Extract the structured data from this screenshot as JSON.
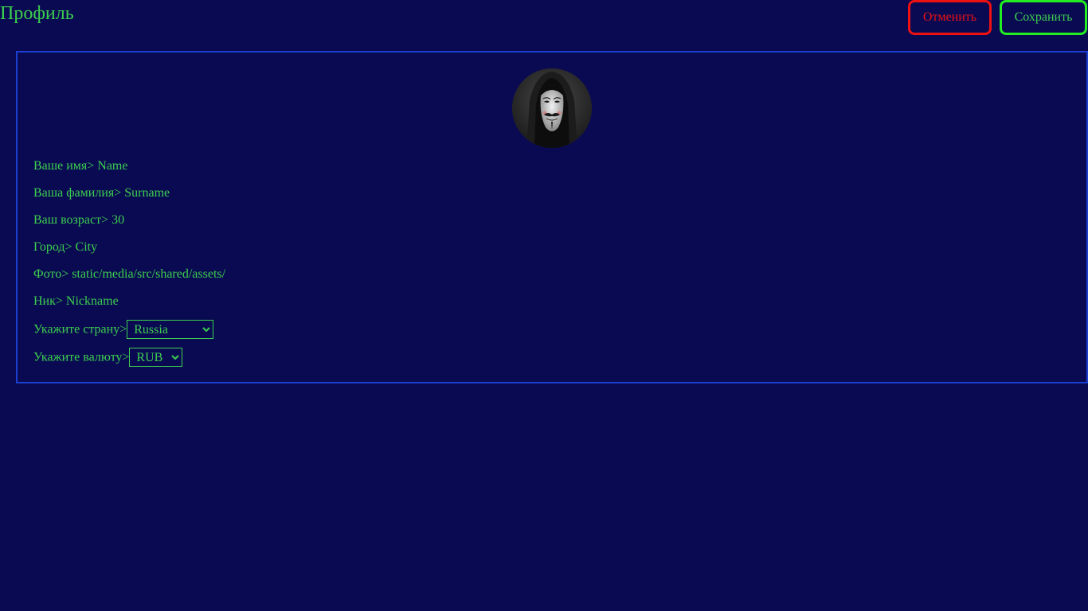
{
  "header": {
    "title": "Профиль",
    "cancel_label": "Отменить",
    "save_label": "Сохранить"
  },
  "profile": {
    "fields": [
      {
        "label": "Ваше имя>",
        "value": "Name"
      },
      {
        "label": "Ваша фамилия>",
        "value": "Surname"
      },
      {
        "label": "Ваш возраст>",
        "value": "30"
      },
      {
        "label": "Город>",
        "value": "City"
      },
      {
        "label": "Фото>",
        "value": "static/media/src/shared/assets/"
      },
      {
        "label": "Ник>",
        "value": "Nickname"
      }
    ],
    "country": {
      "label": "Укажите страну>",
      "selected": "Russia"
    },
    "currency": {
      "label": "Укажите валюту>",
      "selected": "RUB"
    }
  },
  "colors": {
    "background": "#0a0a52",
    "text": "#3ccf4e",
    "cancel": "#ee1111",
    "save": "#22ee22",
    "card_border": "#1b3fd0"
  }
}
